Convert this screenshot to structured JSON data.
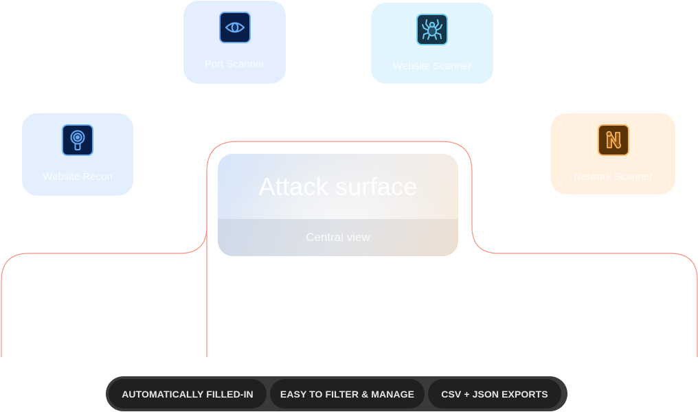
{
  "tools": [
    {
      "id": "port",
      "label": "Port Scanner",
      "icon": "eye-icon"
    },
    {
      "id": "website-scanner",
      "label": "Website Scanner",
      "icon": "spider-icon"
    },
    {
      "id": "recon",
      "label": "Website Recon",
      "icon": "magnifier-target-icon"
    },
    {
      "id": "network",
      "label": "Network Scanner",
      "icon": "network-n-icon"
    }
  ],
  "central": {
    "title": "Attack surface",
    "subtitle": "Central view"
  },
  "features": [
    {
      "label": "AUTOMATICALLY FILLED-IN"
    },
    {
      "label": "EASY TO FILTER & MANAGE"
    },
    {
      "label": "CSV + JSON EXPORTS"
    }
  ],
  "colors": {
    "connector": "#f6907f",
    "blue_accent": "#6aabf3",
    "cyan_accent": "#6fcdef",
    "orange_accent": "#f6b35a",
    "pill_bar": "#3a3a3a",
    "pill": "#202020"
  }
}
